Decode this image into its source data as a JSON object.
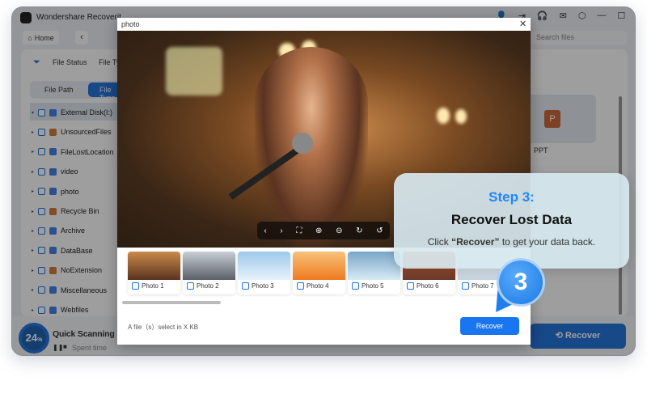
{
  "app": {
    "title": "Wondershare Recoverit",
    "home": "Home",
    "search_placeholder": "Search files"
  },
  "filters": {
    "file_status": "File Status",
    "file_type": "File Type"
  },
  "tabs": {
    "file_path": "File Path",
    "file_type": "File Type"
  },
  "tree": [
    "External Disk(I:)",
    "UnsourcedFiles",
    "FileLostLocation",
    "video",
    "photo",
    "Recycle Bin",
    "Archive",
    "DataBase",
    "NoExtension",
    "Miscellaneous",
    "Webfiles"
  ],
  "right_card": {
    "label": "PPT"
  },
  "scan": {
    "percent": "24",
    "percent_sign": "%",
    "title": "Quick Scanning",
    "spent": "Spent time"
  },
  "bg_recover": "Recover",
  "modal": {
    "title": "photo",
    "thumbs": [
      "Photo 1",
      "Photo 2",
      "Photo 3",
      "Photo 4",
      "Photo 5",
      "Photo 6",
      "Photo 7"
    ],
    "status": "A file（s）select in X KB",
    "recover": "Recover"
  },
  "tooltip": {
    "step": "Step 3:",
    "title": "Recover Lost Data",
    "desc_pre": "Click ",
    "desc_bold": "“Recover”",
    "desc_post": " to get your data back.",
    "badge": "3"
  },
  "colors": {
    "accent": "#1976f0"
  }
}
